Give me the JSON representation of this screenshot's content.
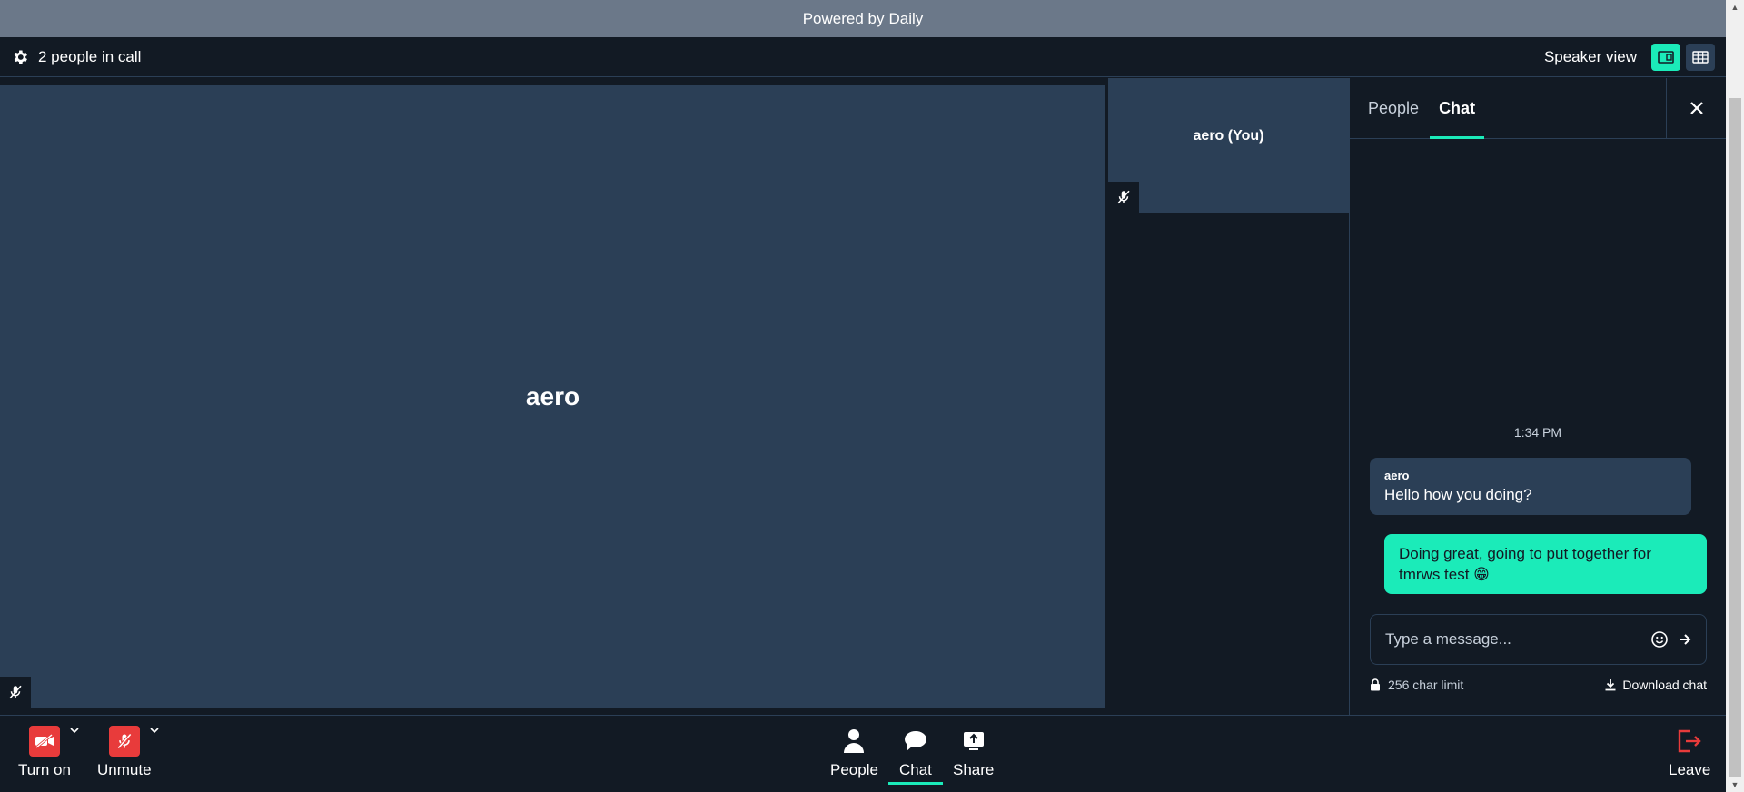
{
  "banner": {
    "prefix": "Powered by",
    "link": "Daily"
  },
  "topbar": {
    "people_count": "2 people in call",
    "view_label": "Speaker view"
  },
  "main_tile": {
    "name": "aero"
  },
  "self_tile": {
    "name": "aero (You)"
  },
  "sidebar": {
    "tabs": [
      {
        "label": "People"
      },
      {
        "label": "Chat"
      }
    ],
    "active_tab": "Chat",
    "timestamp": "1:34 PM",
    "messages": [
      {
        "author": "aero",
        "text": "Hello how you doing?"
      },
      {
        "author": "",
        "text": "Doing great, going to put together for tmrws test 😁"
      }
    ],
    "input_placeholder": "Type a message...",
    "char_limit": "256 char limit",
    "download_label": "Download chat"
  },
  "bottombar": {
    "camera_label": "Turn on",
    "mic_label": "Unmute",
    "people_label": "People",
    "chat_label": "Chat",
    "share_label": "Share",
    "leave_label": "Leave"
  },
  "colors": {
    "accent": "#1bebb9",
    "danger": "#e83b3b",
    "tile": "#2b3f56",
    "background": "#121a24"
  }
}
